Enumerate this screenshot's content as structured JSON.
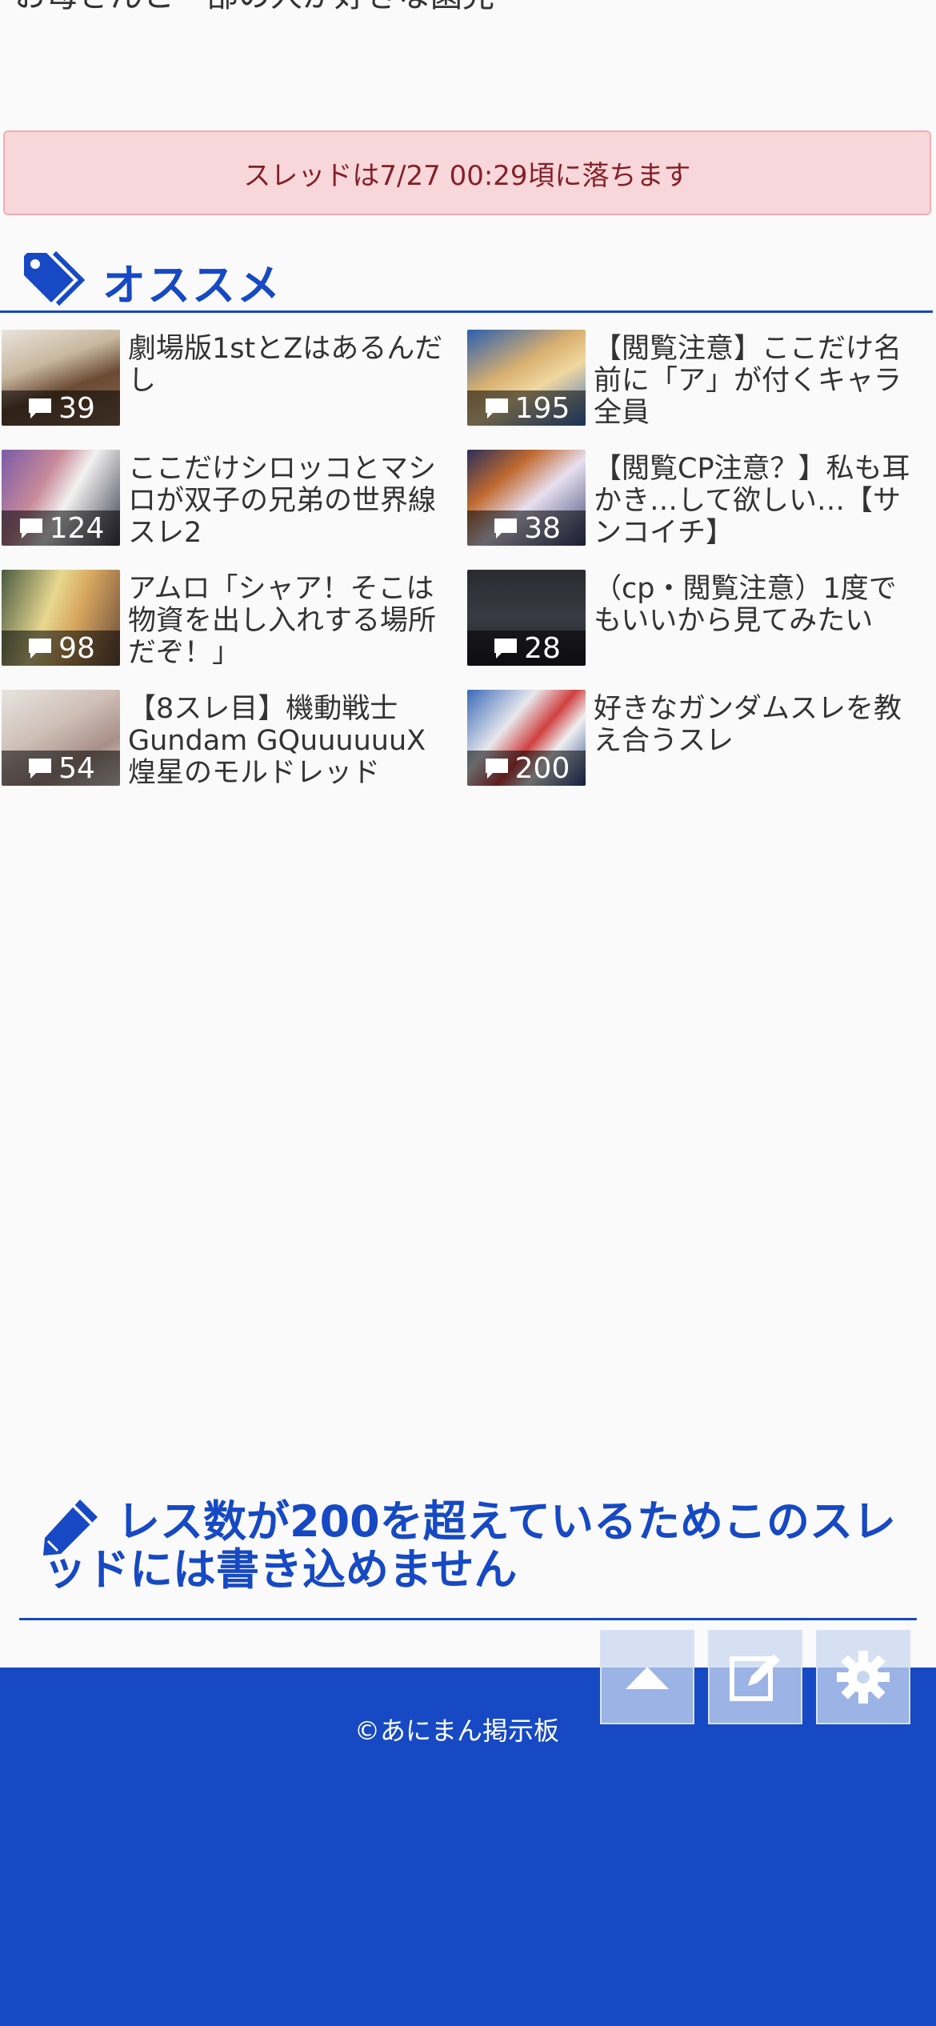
{
  "page": {
    "top_text": "お母さんと一部の人が好きな園児"
  },
  "notice": {
    "text": "スレッドは7/27 00:29頃に落ちます"
  },
  "recommend": {
    "title": "オススメ",
    "threads": [
      {
        "title": "劇場版1stとZはあるんだし",
        "count": "39"
      },
      {
        "title": "【閲覧注意】ここだけ名前に「ア」が付くキャラ全員",
        "count": "195"
      },
      {
        "title": "ここだけシロッコとマシロが双子の兄弟の世界線スレ2",
        "count": "124"
      },
      {
        "title": "【閲覧CP注意？】私も耳かき…して欲しい…【サンコイチ】",
        "count": "38"
      },
      {
        "title": "アムロ「シャア！そこは物資を出し入れする場所だぞ！」",
        "count": "98"
      },
      {
        "title": "（cp・閲覧注意）1度でもいいから見てみたい",
        "count": "28"
      },
      {
        "title": "【8スレ目】機動戦士Gundam GQuuuuuuX 煌星のモルドレッド",
        "count": "54"
      },
      {
        "title": "好きなガンダムスレを教え合うスレ",
        "count": "200"
      }
    ]
  },
  "write": {
    "message": "レス数が200を超えているためこのスレッドには書き込めません"
  },
  "footer": {
    "copyright": "©あにまん掲示板"
  },
  "icons": {
    "tag": "tag-icon",
    "comment": "comment-icon",
    "pencil": "pencil-icon",
    "scroll_top": "arrow-up-icon",
    "edit": "edit-icon",
    "settings": "gear-icon"
  },
  "colors": {
    "accent": "#1649c3",
    "notice_bg": "#f8d7da",
    "notice_text": "#842029"
  }
}
